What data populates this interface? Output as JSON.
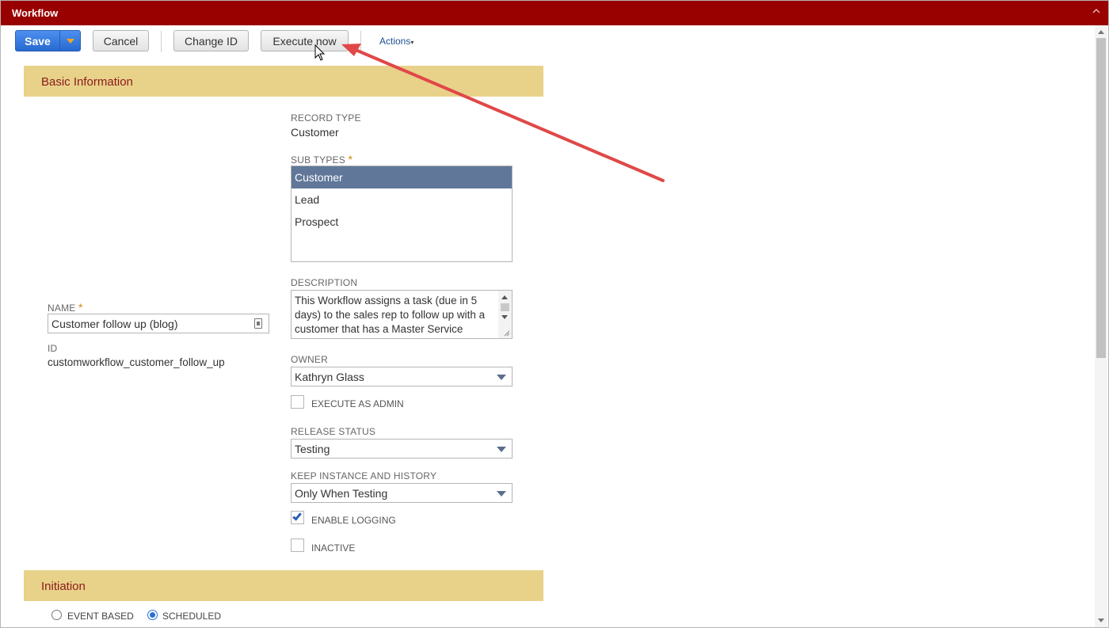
{
  "window": {
    "title": "Workflow"
  },
  "toolbar": {
    "save_label": "Save",
    "cancel_label": "Cancel",
    "change_id_label": "Change ID",
    "execute_now_label": "Execute now",
    "actions_label": "Actions",
    "actions_caret": "▾"
  },
  "basic_info": {
    "header": "Basic Information",
    "record_type_label": "RECORD TYPE",
    "record_type_value": "Customer",
    "sub_types_label": "SUB TYPES",
    "required_mark": "*",
    "sub_types": [
      {
        "label": "Customer",
        "selected": true
      },
      {
        "label": "Lead",
        "selected": false
      },
      {
        "label": "Prospect",
        "selected": false
      }
    ],
    "name_label": "NAME",
    "name_value": "Customer follow up (blog)",
    "id_label": "ID",
    "id_value": "customworkflow_customer_follow_up",
    "description_label": "DESCRIPTION",
    "description_value": "This Workflow assigns a task (due in 5 days) to the sales rep to follow up with a customer that has a Master Service",
    "owner_label": "OWNER",
    "owner_value": "Kathryn Glass",
    "execute_as_admin_label": "EXECUTE AS ADMIN",
    "execute_as_admin_checked": false,
    "release_status_label": "RELEASE STATUS",
    "release_status_value": "Testing",
    "keep_instance_label": "KEEP INSTANCE AND HISTORY",
    "keep_instance_value": "Only When Testing",
    "enable_logging_label": "ENABLE LOGGING",
    "enable_logging_checked": true,
    "inactive_label": "INACTIVE",
    "inactive_checked": false
  },
  "initiation": {
    "header": "Initiation",
    "event_based_label": "EVENT BASED",
    "scheduled_label": "SCHEDULED",
    "selected": "SCHEDULED"
  },
  "colors": {
    "titlebar": "#990000",
    "section_header_bg": "#e8d28a",
    "section_header_text": "#8b1a1a",
    "save_button": "#2769d0",
    "annotation_arrow": "#e04848"
  }
}
